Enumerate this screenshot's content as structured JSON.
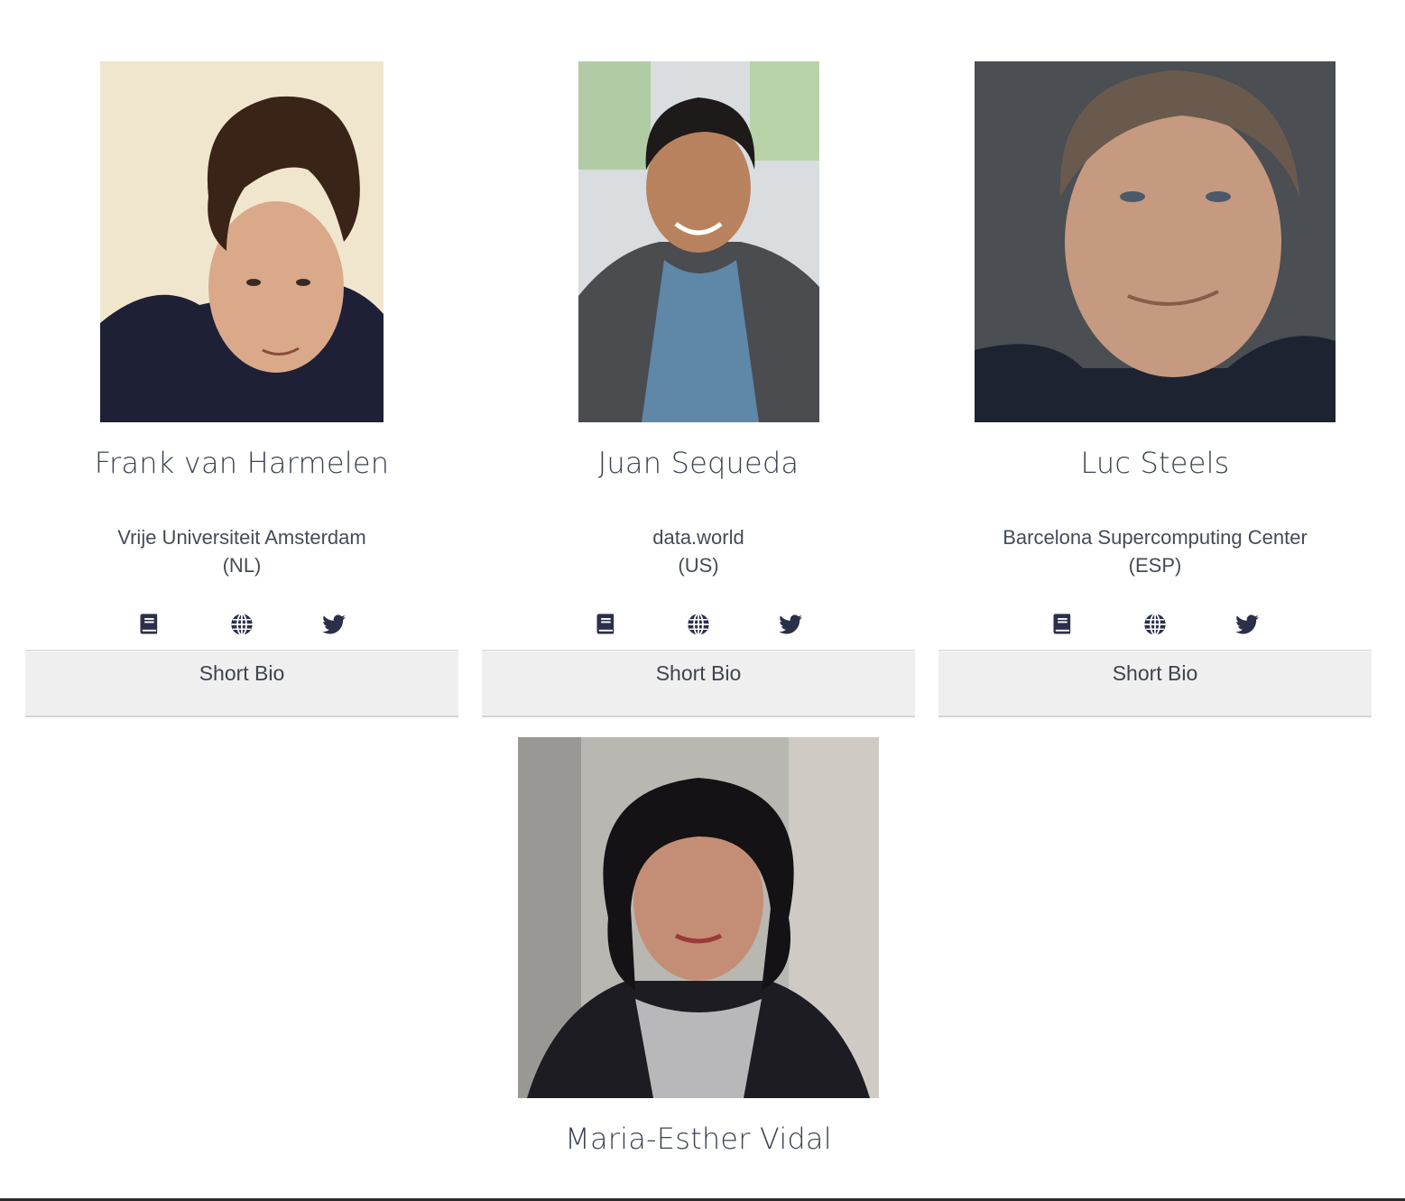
{
  "speakers": [
    {
      "name": "Frank van Harmelen",
      "affiliation": "Vrije Universiteit Amsterdam",
      "country": "(NL)",
      "bio_label": "Short Bio",
      "icons": [
        "book-icon",
        "globe-icon",
        "twitter-icon"
      ]
    },
    {
      "name": "Juan Sequeda",
      "affiliation": "data.world",
      "country": "(US)",
      "bio_label": "Short Bio",
      "icons": [
        "book-icon",
        "globe-icon",
        "twitter-icon"
      ]
    },
    {
      "name": "Luc Steels",
      "affiliation": "Barcelona Supercomputing Center",
      "country": "(ESP)",
      "bio_label": "Short Bio",
      "icons": [
        "book-icon",
        "globe-icon",
        "twitter-icon"
      ]
    },
    {
      "name": "Maria-Esther Vidal"
    }
  ],
  "colors": {
    "icon": "#2b2f4a",
    "bio_bg": "#efefef",
    "text": "#3b4250"
  }
}
